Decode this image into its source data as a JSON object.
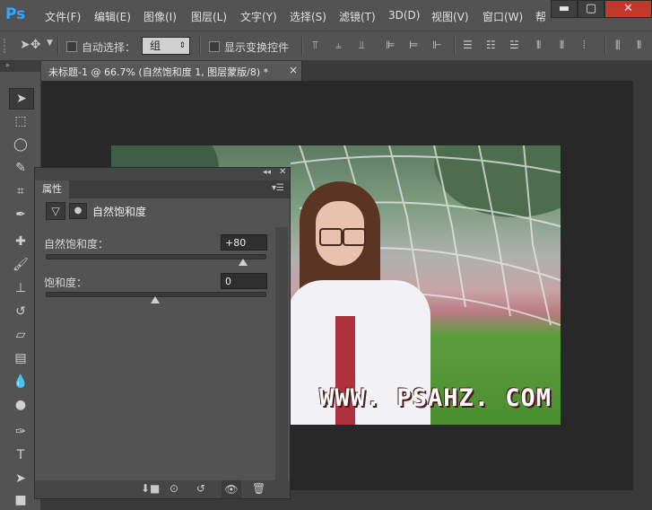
{
  "app": {
    "logo": "Ps"
  },
  "menu": {
    "items": [
      "文件(F)",
      "编辑(E)",
      "图像(I)",
      "图层(L)",
      "文字(Y)",
      "选择(S)",
      "滤镜(T)",
      "3D(D)",
      "视图(V)",
      "窗口(W)",
      "帮"
    ]
  },
  "window_controls": {
    "minimize": "▬",
    "maximize": "▢",
    "close": "✕"
  },
  "options_bar": {
    "auto_select_label": "自动选择：",
    "auto_select_value": "组",
    "show_transform_label": "显示变换控件"
  },
  "document": {
    "tab_title": "未标题-1 @ 66.7% (自然饱和度 1, 图层蒙版/8) *",
    "tab_close": "×",
    "watermark": "WWW. PSAHZ. COM"
  },
  "properties_panel": {
    "tab_label": "属性",
    "title": "自然饱和度",
    "vibrance": {
      "label": "自然饱和度：",
      "value": "+80",
      "level": 0.9
    },
    "saturation": {
      "label": "饱和度：",
      "value": "0",
      "level": 0.5
    }
  },
  "colors": {
    "ps_blue": "#31a8ff",
    "panel_bg": "#535353",
    "workspace_bg": "#282828"
  }
}
